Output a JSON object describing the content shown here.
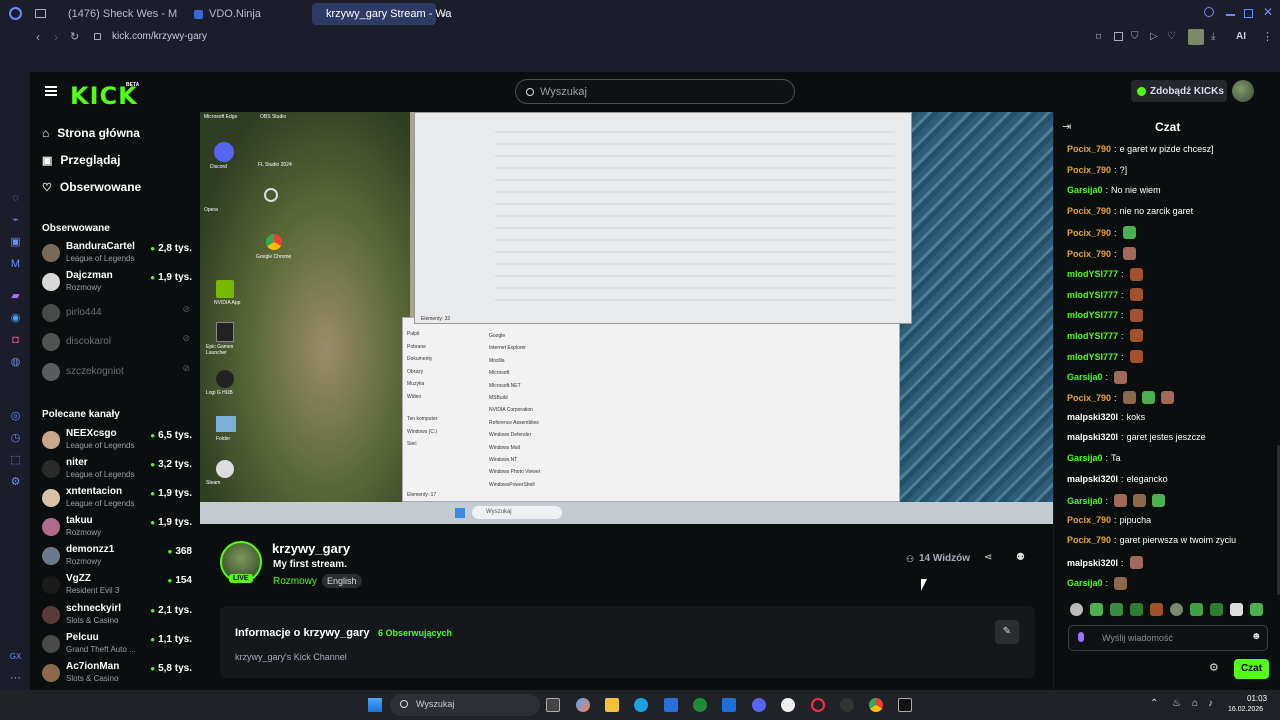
{
  "browser": {
    "tabs": [
      {
        "label": "(1476) Sheck Wes - M"
      },
      {
        "label": "VDO.Ninja"
      },
      {
        "label": "krzywy_gary Stream - Wa"
      }
    ],
    "url": "kick.com/krzywy-gary",
    "ai_label": "AI"
  },
  "header": {
    "logo": "KICK",
    "logo_beta": "BETA",
    "search_placeholder": "Wyszukaj",
    "kicks_button": "Zdobądź KICKs"
  },
  "sidebar": {
    "nav": [
      {
        "label": "Strona główna",
        "icon": "home-icon"
      },
      {
        "label": "Przeglądaj",
        "icon": "browse-icon"
      },
      {
        "label": "Obserwowane",
        "icon": "heart-icon"
      }
    ],
    "following_title": "Obserwowane",
    "following": [
      {
        "name": "BanduraCartel",
        "category": "League of Legends",
        "viewers": "2,8 tys.",
        "live": true
      },
      {
        "name": "Dajczman",
        "category": "Rozmowy",
        "viewers": "1,9 tys.",
        "live": true
      },
      {
        "name": "pirlo444",
        "category": "",
        "viewers": "",
        "live": false
      },
      {
        "name": "discokarol",
        "category": "",
        "viewers": "",
        "live": false
      },
      {
        "name": "szczekogniot",
        "category": "",
        "viewers": "",
        "live": false
      }
    ],
    "recommended_title": "Polecane kanały",
    "recommended": [
      {
        "name": "NEEXcsgo",
        "category": "League of Legends",
        "viewers": "6,5 tys."
      },
      {
        "name": "niter",
        "category": "League of Legends",
        "viewers": "3,2 tys."
      },
      {
        "name": "xntentacion",
        "category": "League of Legends",
        "viewers": "1,9 tys."
      },
      {
        "name": "takuu",
        "category": "Rozmowy",
        "viewers": "1,9 tys."
      },
      {
        "name": "demonzz1",
        "category": "Rozmowy",
        "viewers": "368"
      },
      {
        "name": "VgZZ",
        "category": "Resident Evil 3",
        "viewers": "154"
      },
      {
        "name": "schneckyirl",
        "category": "Slots & Casino",
        "viewers": "2,1 tys."
      },
      {
        "name": "Pelcuu",
        "category": "Grand Theft Auto ...",
        "viewers": "1,1 tys."
      },
      {
        "name": "Ac7ionMan",
        "category": "Slots & Casino",
        "viewers": "5,8 tys."
      }
    ]
  },
  "video": {
    "desktop_icons": [
      "Microsoft Edge",
      "OBS Studio",
      "Discord",
      "FL Studio 2024",
      "Opera",
      "Google Chrome",
      "NVIDIA App",
      "Epic Games Launcher",
      "Logi G HUB",
      "Folder",
      "Steam"
    ],
    "taskbar_search": "Wyszukaj",
    "explorer_status_top": "Elementy: 32",
    "explorer_status_bottom": "Elementy: 17",
    "explorer_nav": [
      "Pulpit",
      "Pobrane",
      "Dokumenty",
      "Obrazy",
      "Muzyka",
      "Wideo",
      "Ten komputer",
      "Windows (C:)",
      "Sieć"
    ],
    "explorer_files_bottom": [
      "Google",
      "Internet Explorer",
      "Mozilla",
      "Microsoft",
      "Microsoft.NET",
      "MSBuild",
      "NVIDIA Corporation",
      "Reference Assemblies",
      "Windows Defender",
      "Windows Mail",
      "Windows NT",
      "Windows Photo Viewer",
      "WindowsPowerShell"
    ]
  },
  "channel": {
    "name": "krzywy_gary",
    "title": "My first stream.",
    "category": "Rozmowy",
    "language": "English",
    "live_badge": "LIVE",
    "viewers": "14 Widzów",
    "about_title": "Informacje o krzywy_gary",
    "followers": "6 Obserwujących",
    "description": "krzywy_gary's Kick Channel"
  },
  "chat": {
    "title": "Czat",
    "messages": [
      {
        "user": "Pocix_790",
        "text": "e garet w pizde chcesz]",
        "color": "#e6a33a",
        "emotes": 0
      },
      {
        "user": "Pocix_790",
        "text": "?]",
        "color": "#e6a33a",
        "emotes": 0
      },
      {
        "user": "Garsija0",
        "text": "No nie wiem",
        "color": "#53fc18",
        "emotes": 0
      },
      {
        "user": "Pocix_790",
        "text": "nie no zarcik garet",
        "color": "#e6a33a",
        "emotes": 0
      },
      {
        "user": "Pocix_790",
        "text": "",
        "color": "#e6a33a",
        "emotes": 1
      },
      {
        "user": "Pocix_790",
        "text": "",
        "color": "#e6a33a",
        "emotes": 1
      },
      {
        "user": "mlodYSI777",
        "text": "",
        "color": "#53fc18",
        "emotes": 1
      },
      {
        "user": "mlodYSI777",
        "text": "",
        "color": "#53fc18",
        "emotes": 1
      },
      {
        "user": "mlodYSI777",
        "text": "",
        "color": "#53fc18",
        "emotes": 1
      },
      {
        "user": "mlodYSI777",
        "text": "",
        "color": "#53fc18",
        "emotes": 1
      },
      {
        "user": "mlodYSI777",
        "text": "",
        "color": "#53fc18",
        "emotes": 1
      },
      {
        "user": "Garsija0",
        "text": "",
        "color": "#53fc18",
        "emotes": 1
      },
      {
        "user": "Pocix_790",
        "text": "",
        "color": "#e6a33a",
        "emotes": 3
      },
      {
        "user": "malpski320l",
        "text": "koks",
        "color": "#ffffff",
        "emotes": 0
      },
      {
        "user": "malpski320l",
        "text": "garet jestes jeszcze",
        "color": "#ffffff",
        "emotes": 0
      },
      {
        "user": "Garsija0",
        "text": "Ta",
        "color": "#53fc18",
        "emotes": 0
      },
      {
        "user": "malpski320l",
        "text": "eleganckо",
        "color": "#ffffff",
        "emotes": 0
      },
      {
        "user": "Garsija0",
        "text": "",
        "color": "#53fc18",
        "emotes": 3
      },
      {
        "user": "Pocix_790",
        "text": "pipucha",
        "color": "#e6a33a",
        "emotes": 0
      },
      {
        "user": "Pocix_790",
        "text": "garet pierwsza w twoim zyciu",
        "color": "#e6a33a",
        "emotes": 0
      },
      {
        "user": "malpski320l",
        "text": "",
        "color": "#ffffff",
        "emotes": 1
      },
      {
        "user": "Garsija0",
        "text": "",
        "color": "#53fc18",
        "emotes": 1
      }
    ],
    "input_placeholder": "Wyślij wiadomość",
    "send_button": "Czat"
  },
  "taskbar": {
    "search_placeholder": "Wyszukaj",
    "time": "01:03",
    "date": "16.02.2026"
  },
  "colors": {
    "kick_green": "#53fc18",
    "bg": "#0b0e0f",
    "chrome": "#1b1d2a"
  }
}
